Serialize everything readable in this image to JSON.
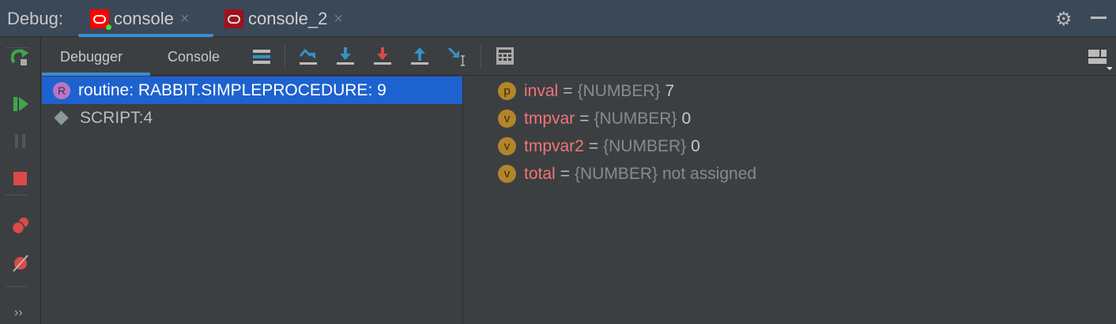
{
  "header": {
    "label": "Debug:",
    "tabs": [
      {
        "label": "console",
        "close": "×"
      },
      {
        "label": "console_2",
        "close": "×"
      }
    ]
  },
  "toolbar": {
    "tabs": [
      "Debugger",
      "Console"
    ]
  },
  "left_toolbar": {
    "more": "››"
  },
  "frames": [
    {
      "badge": "R",
      "label": "routine: RABBIT.SIMPLEPROCEDURE: 9"
    },
    {
      "label": "SCRIPT:4"
    }
  ],
  "variables": [
    {
      "badge": "p",
      "name": "inval",
      "eq": "=",
      "type": "{NUMBER}",
      "value": "7"
    },
    {
      "badge": "v",
      "name": "tmpvar",
      "eq": "=",
      "type": "{NUMBER}",
      "value": "0"
    },
    {
      "badge": "v",
      "name": "tmpvar2",
      "eq": "=",
      "type": "{NUMBER}",
      "value": "0"
    },
    {
      "badge": "v",
      "name": "total",
      "eq": "=",
      "type": "{NUMBER}",
      "value": "not assigned"
    }
  ],
  "colors": {
    "accent": "#3d8ad7",
    "selection": "#1d62cf",
    "var_name": "#f07578"
  }
}
